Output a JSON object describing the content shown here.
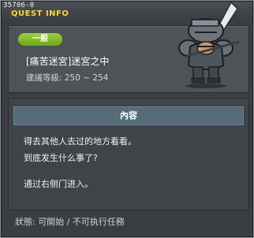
{
  "window": {
    "quest_id": "35706-0",
    "title": "QUEST INFO"
  },
  "quest": {
    "category": "一般",
    "name": "[痛苦迷宮]迷宮之中",
    "level_requirement": "建議等級: 250 ~ 254"
  },
  "content": {
    "header": "內容",
    "lines": [
      "得去其他人去过的地方看看。",
      "到底发生什么事了?",
      "通过右侧门进入。"
    ]
  },
  "status": "狀態: 可開始 / 不可执行任務",
  "colors": {
    "title": "#ffd53a",
    "badge": "#8cc63f",
    "content_header": "#556c79"
  },
  "icons": {
    "portrait": "armored-knight-portrait"
  }
}
